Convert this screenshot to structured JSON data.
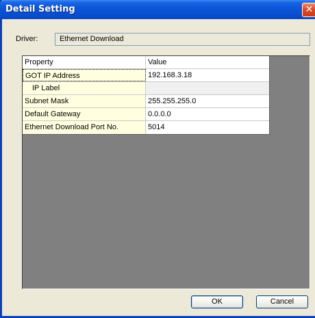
{
  "window": {
    "title": "Detail Setting",
    "close_symbol": "✕"
  },
  "driver": {
    "label": "Driver:",
    "value": "Ethernet Download"
  },
  "table": {
    "headers": {
      "property": "Property",
      "value": "Value"
    },
    "rows": [
      {
        "property": "GOT IP Address",
        "value": "192.168.3.18"
      },
      {
        "property": "IP Label",
        "value": ""
      },
      {
        "property": "Subnet Mask",
        "value": "255.255.255.0"
      },
      {
        "property": "Default Gateway",
        "value": "0.0.0.0"
      },
      {
        "property": "Ethernet Download Port No.",
        "value": "5014"
      }
    ]
  },
  "buttons": {
    "ok": "OK",
    "cancel": "Cancel"
  }
}
